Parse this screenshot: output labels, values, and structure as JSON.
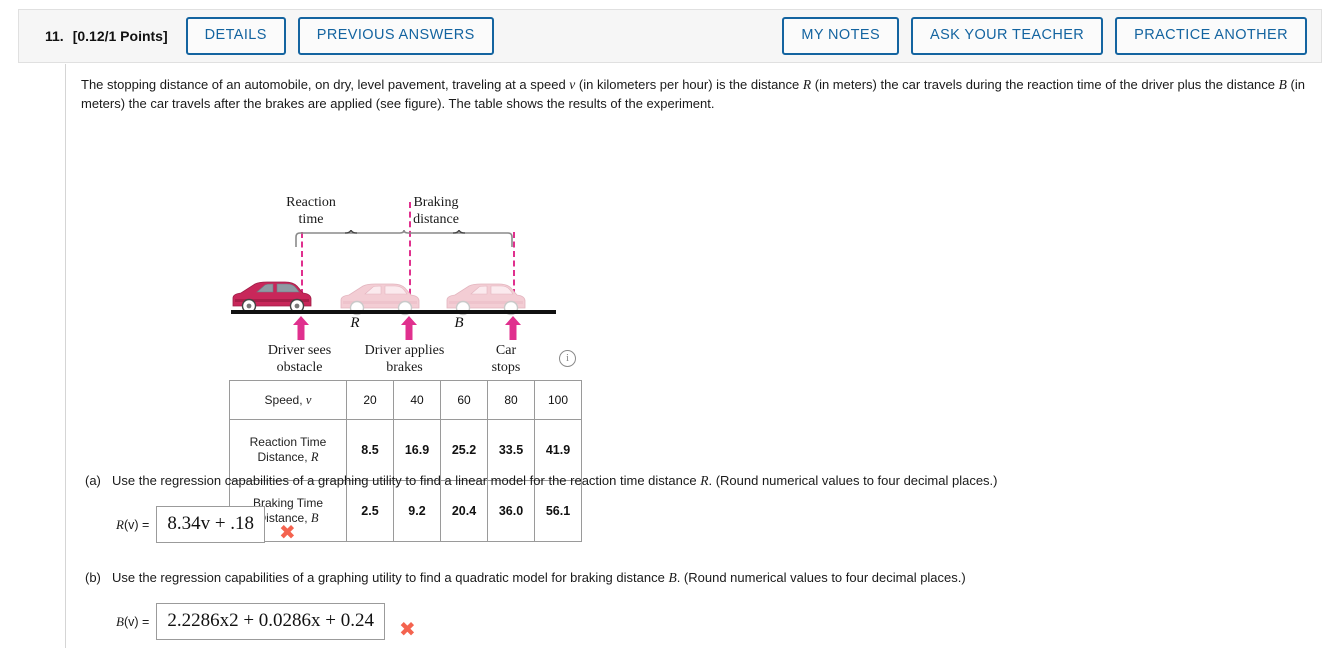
{
  "header": {
    "question_number": "11.",
    "points": "[0.12/1 Points]",
    "left_buttons": [
      {
        "label": "DETAILS",
        "name": "details-button"
      },
      {
        "label": "PREVIOUS ANSWERS",
        "name": "previous-answers-button"
      }
    ],
    "right_buttons": [
      {
        "label": "MY NOTES",
        "name": "my-notes-button"
      },
      {
        "label": "ASK YOUR TEACHER",
        "name": "ask-your-teacher-button"
      },
      {
        "label": "PRACTICE ANOTHER",
        "name": "practice-another-button"
      }
    ],
    "accent_color": "#1464a0",
    "background_color": "#f6f6f6"
  },
  "problem": {
    "text_1": "The stopping distance of an automobile, on dry, level pavement, traveling at a speed ",
    "var_v": "v",
    "text_2": " (in kilometers per hour) is the distance ",
    "var_R": "R",
    "text_3": " (in meters) the car travels during the reaction time of the driver plus the distance ",
    "var_B": "B",
    "text_4": " (in meters) the car travels after the brakes are applied (see figure). The table shows the results of the experiment."
  },
  "figure": {
    "top_label_left": "Reaction\ntime",
    "top_label_left_line1": "Reaction",
    "top_label_left_line2": "time",
    "top_label_right_line1": "Braking",
    "top_label_right_line2": "distance",
    "segment_label_R": "R",
    "segment_label_B": "B",
    "bottom_label_1_line1": "Driver sees",
    "bottom_label_1_line2": "obstacle",
    "bottom_label_2_line1": "Driver applies",
    "bottom_label_2_line2": "brakes",
    "bottom_label_3_line1": "Car",
    "bottom_label_3_line2": "stops",
    "info_icon": "i",
    "colors": {
      "dash_and_arrow": "#e0308e",
      "car_red": "#c8275a",
      "car_faded": "#f3cdd4",
      "road": "#111111",
      "brace": "#8a8a8a"
    }
  },
  "table": {
    "rows": [
      {
        "header_text": "Speed, ",
        "header_var": "v",
        "values": [
          "20",
          "40",
          "60",
          "80",
          "100"
        ]
      },
      {
        "header_line1": "Reaction Time",
        "header_line2_text": "Distance, ",
        "header_line2_var": "R",
        "values": [
          "8.5",
          "16.9",
          "25.2",
          "33.5",
          "41.9"
        ]
      },
      {
        "header_line1": "Braking Time",
        "header_line2_text": "Distance, ",
        "header_line2_var": "B",
        "values": [
          "2.5",
          "9.2",
          "20.4",
          "36.0",
          "56.1"
        ]
      }
    ]
  },
  "part_a": {
    "letter": "(a)",
    "prompt_1": "Use the regression capabilities of a graphing utility to find a linear model for the reaction time distance ",
    "prompt_var": "R",
    "prompt_2": ". (Round numerical values to four decimal places.)",
    "answer_label_prefix": "R",
    "answer_label_arg": "(v)",
    "answer_label_eq": " = ",
    "answer_value": "8.34v + .18",
    "status_mark": "✖",
    "status_color": "#f4634f"
  },
  "part_b": {
    "letter": "(b)",
    "prompt_1": "Use the regression capabilities of a graphing utility to find a quadratic model for braking distance ",
    "prompt_var": "B",
    "prompt_2": ". (Round numerical values to four decimal places.)",
    "answer_label_prefix": "B",
    "answer_label_arg": "(v)",
    "answer_label_eq": " = ",
    "answer_value": "2.2286x2 + 0.0286x + 0.24",
    "status_mark": "✖",
    "status_color": "#f4634f"
  }
}
